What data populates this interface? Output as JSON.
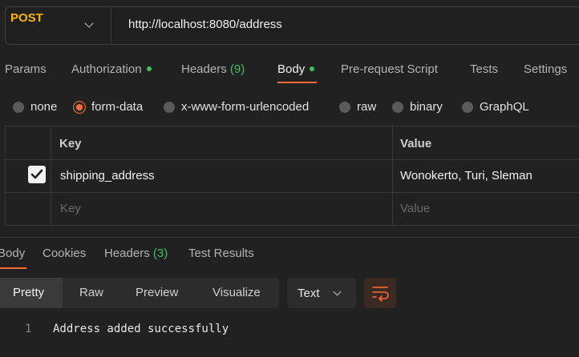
{
  "request": {
    "method": "POST",
    "url": "http://localhost:8080/address"
  },
  "request_tabs": [
    {
      "label": "Params"
    },
    {
      "label": "Authorization",
      "dot": true
    },
    {
      "label": "Headers",
      "count": "(9)"
    },
    {
      "label": "Body",
      "dot": true,
      "active": true
    },
    {
      "label": "Pre-request Script"
    },
    {
      "label": "Tests"
    },
    {
      "label": "Settings"
    }
  ],
  "body_types": [
    {
      "label": "none"
    },
    {
      "label": "form-data",
      "selected": true
    },
    {
      "label": "x-www-form-urlencoded"
    },
    {
      "label": "raw"
    },
    {
      "label": "binary"
    },
    {
      "label": "GraphQL"
    }
  ],
  "form_table": {
    "headers": {
      "key": "Key",
      "value": "Value"
    },
    "rows": [
      {
        "checked": true,
        "key": "shipping_address",
        "value": "Wonokerto, Turi, Sleman"
      }
    ],
    "placeholders": {
      "key": "Key",
      "value": "Value"
    }
  },
  "response_tabs": [
    {
      "label": "Body",
      "active": true
    },
    {
      "label": "Cookies"
    },
    {
      "label": "Headers",
      "count": "(3)"
    },
    {
      "label": "Test Results"
    }
  ],
  "view_modes": [
    {
      "label": "Pretty",
      "active": true
    },
    {
      "label": "Raw"
    },
    {
      "label": "Preview"
    },
    {
      "label": "Visualize"
    }
  ],
  "format_select": "Text",
  "response_body": [
    {
      "line": "1",
      "text": "Address added successfully"
    }
  ],
  "colors": {
    "accent": "#ff6c37",
    "method": "#ffb400",
    "status_green": "#3fbf60"
  },
  "icons": {
    "method_dropdown": "chevron-down-icon",
    "format_dropdown": "chevron-down-icon",
    "wrap": "wrap-lines-icon",
    "checkbox": "checkmark-icon"
  }
}
